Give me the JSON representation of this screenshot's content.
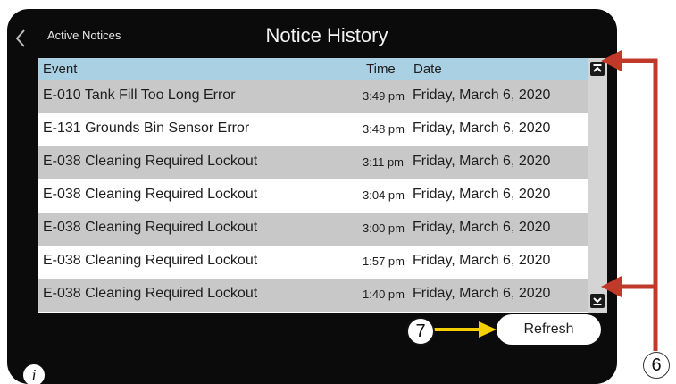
{
  "header": {
    "back_label": "Active Notices",
    "title": "Notice History"
  },
  "table": {
    "columns": {
      "event": "Event",
      "time": "Time",
      "date": "Date"
    },
    "rows": [
      {
        "event": "E-010 Tank Fill Too Long Error",
        "time": "3:49 pm",
        "date": "Friday, March 6, 2020"
      },
      {
        "event": "E-131 Grounds Bin Sensor Error",
        "time": "3:48 pm",
        "date": "Friday, March 6, 2020"
      },
      {
        "event": "E-038 Cleaning Required Lockout",
        "time": "3:11 pm",
        "date": "Friday, March 6, 2020"
      },
      {
        "event": "E-038 Cleaning Required Lockout",
        "time": "3:04 pm",
        "date": "Friday, March 6, 2020"
      },
      {
        "event": "E-038 Cleaning Required Lockout",
        "time": "3:00 pm",
        "date": "Friday, March 6, 2020"
      },
      {
        "event": "E-038 Cleaning Required Lockout",
        "time": "1:57 pm",
        "date": "Friday, March 6, 2020"
      },
      {
        "event": "E-038 Cleaning Required Lockout",
        "time": "1:40 pm",
        "date": "Friday, March 6, 2020"
      }
    ]
  },
  "actions": {
    "refresh_label": "Refresh"
  },
  "info": {
    "label": "i"
  },
  "callouts": {
    "refresh": "7",
    "scroll": "6"
  },
  "colors": {
    "screen_bg": "#0b0b0b",
    "header_row": "#a9d1e3",
    "row_shade": "#c8c8c8",
    "callout_arrow": "#c0392b",
    "callout_arrow_yellow": "#f5d000"
  }
}
